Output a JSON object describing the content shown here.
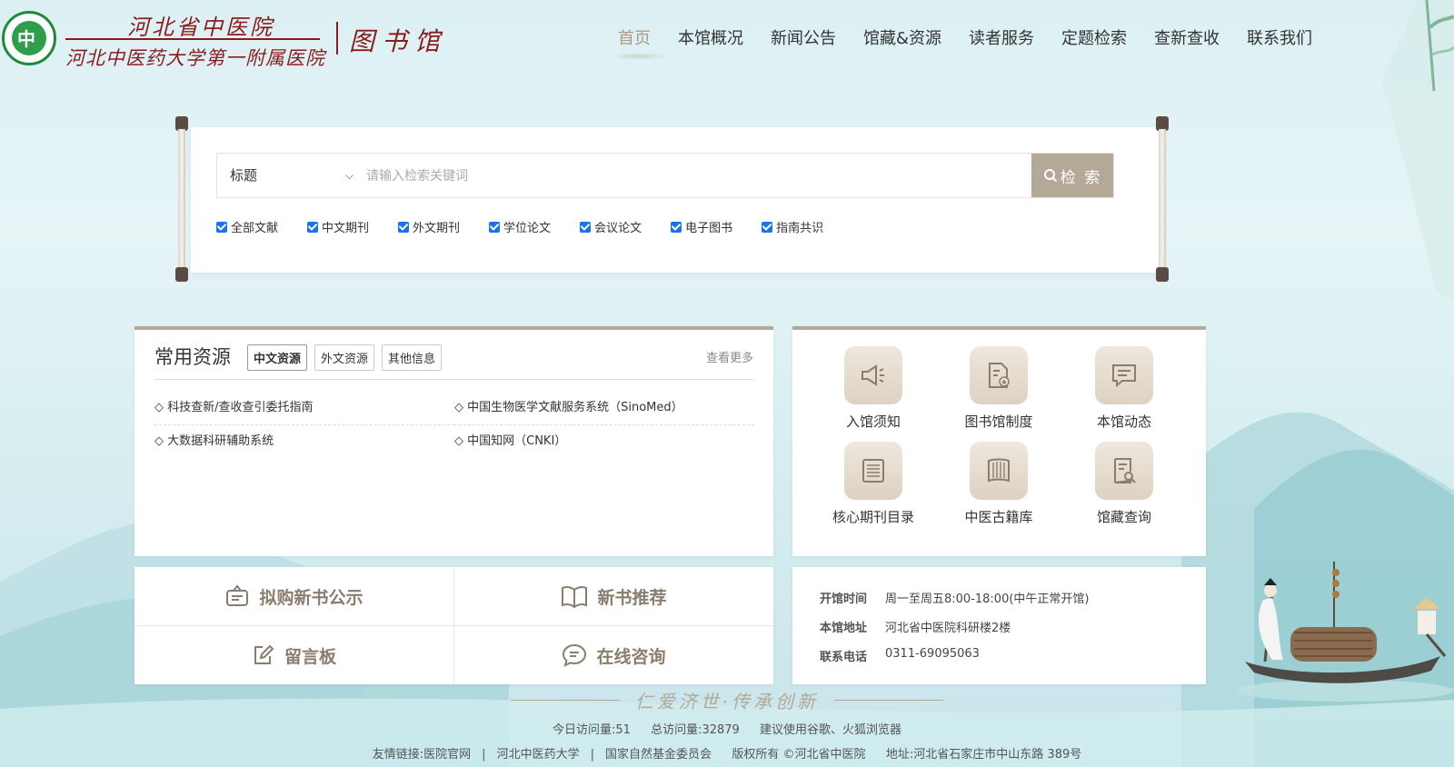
{
  "header": {
    "hospital_name": "河北省中医院",
    "hospital_subtitle": "河北中医药大学第一附属医院",
    "library_name": "图书馆",
    "nav": [
      "首页",
      "本馆概况",
      "新闻公告",
      "馆藏&资源",
      "读者服务",
      "定题检索",
      "查新查收",
      "联系我们"
    ],
    "active_nav": "首页"
  },
  "search": {
    "field_selected": "标题",
    "placeholder": "请输入检索关键词",
    "button_label": "检 索",
    "filters": [
      {
        "label": "全部文献",
        "checked": true
      },
      {
        "label": "中文期刊",
        "checked": true
      },
      {
        "label": "外文期刊",
        "checked": true
      },
      {
        "label": "学位论文",
        "checked": true
      },
      {
        "label": "会议论文",
        "checked": true
      },
      {
        "label": "电子图书",
        "checked": true
      },
      {
        "label": "指南共识",
        "checked": true
      }
    ]
  },
  "resources": {
    "title": "常用资源",
    "tabs": [
      "中文资源",
      "外文资源",
      "其他信息"
    ],
    "active_tab": "中文资源",
    "more_label": "查看更多",
    "items": [
      "◇ 科技查新/查收查引委托指南",
      "◇ 中国生物医学文献服务系统（SinoMed）",
      "◇ 大数据科研辅助系统",
      "◇ 中国知网（CNKI）"
    ]
  },
  "services": [
    {
      "label": "入馆须知",
      "icon": "megaphone-icon"
    },
    {
      "label": "图书馆制度",
      "icon": "document-star-icon"
    },
    {
      "label": "本馆动态",
      "icon": "message-icon"
    },
    {
      "label": "核心期刊目录",
      "icon": "list-icon"
    },
    {
      "label": "中医古籍库",
      "icon": "scroll-icon"
    },
    {
      "label": "馆藏查询",
      "icon": "search-doc-icon"
    }
  ],
  "quick_links": {
    "new_book_notice": "拟购新书公示",
    "new_book_recommend": "新书推荐",
    "message_board": "留言板",
    "online_consult": "在线咨询"
  },
  "info": {
    "hours_key": "开馆时间",
    "hours_val": "周一至周五8:00-18:00(中午正常开馆)",
    "address_key": "本馆地址",
    "address_val": "河北省中医院科研楼2楼",
    "phone_key": "联系电话",
    "phone_val": "0311-69095063"
  },
  "footer": {
    "motto": "仁爱济世·传承创新",
    "today_visits": "今日访问量:51",
    "total_visits": "总访问量:32879",
    "browser_tip": "建议使用谷歌、火狐浏览器",
    "links_prefix": "友情链接:",
    "links": [
      "医院官网",
      "河北中医药大学",
      "国家自然基金委员会"
    ],
    "copyright": "版权所有 ©河北省中医院",
    "address": "地址:河北省石家庄市中山东路 389号"
  },
  "colors": {
    "accent": "#b4a896",
    "brand_red": "#8b1c1c",
    "checkbox": "#1a73e8"
  }
}
